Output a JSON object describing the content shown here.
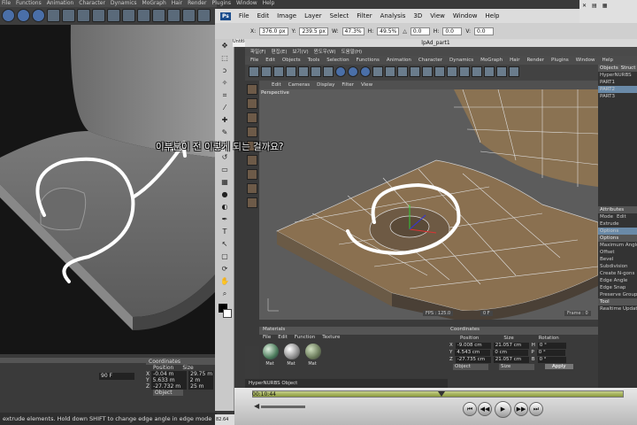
{
  "back_window": {
    "menu": [
      "File",
      "Functions",
      "Animation",
      "Character",
      "Dynamics",
      "MoGraph",
      "Hair",
      "Render",
      "Plugins",
      "Window",
      "Help"
    ],
    "timeline_frame": "90 F",
    "coords": {
      "header": "Coordinates",
      "position_label": "Position",
      "size_label": "Size",
      "rows": [
        {
          "axis": "X",
          "pos": "-0.04 m",
          "size": "29.75 m"
        },
        {
          "axis": "Y",
          "pos": "5.633 m",
          "size": "2 m"
        },
        {
          "axis": "Z",
          "pos": "-27.732 m",
          "size": "25 m"
        }
      ],
      "mode": "Object"
    },
    "status": "extrude elements. Hold down SHIFT to change edge angle in edge mode"
  },
  "photoshop": {
    "logo": "Ps",
    "menu": [
      "File",
      "Edit",
      "Image",
      "Layer",
      "Select",
      "Filter",
      "Analysis",
      "3D",
      "View",
      "Window",
      "Help"
    ],
    "options": [
      {
        "label": "X:",
        "value": "376.0 px"
      },
      {
        "label": "Y:",
        "value": "239.5 px"
      },
      {
        "label": "W:",
        "value": "47.3%"
      },
      {
        "label": "H:",
        "value": "49.5%"
      },
      {
        "label": "",
        "value": "0.0"
      },
      {
        "label": "H:",
        "value": "0.0"
      },
      {
        "label": "V:",
        "value": "0.0"
      }
    ],
    "doc_title": "lpAd_part1",
    "tab_label": "Untitled",
    "zoom": "82.64"
  },
  "inner_c4d": {
    "menu": [
      "파일(F)",
      "편집(E)",
      "보기(V)",
      "윈도우(W)",
      "도움말(H)"
    ],
    "menu2": [
      "File",
      "Edit",
      "Objects",
      "Tools",
      "Selection",
      "Functions",
      "Animation",
      "Character",
      "Dynamics",
      "MoGraph",
      "Hair",
      "Render",
      "Plugins",
      "Window",
      "Help"
    ],
    "view_menu": [
      "Edit",
      "Cameras",
      "Display",
      "Filter",
      "View"
    ],
    "viewport_label": "Perspective",
    "fps": "FPS : 125.0",
    "frame": "0 F",
    "frame_right": "Frame : 0",
    "objects_tab": "Objects",
    "objects_tab2": "Struct",
    "object_list": [
      "HyperNURBS",
      "PART1",
      "PART2",
      "PART3"
    ],
    "attributes_header": "Attributes",
    "attributes_tabs": [
      "Mode",
      "Edit"
    ],
    "attributes_tool": "Extrude",
    "options_tab": "Options",
    "options_header": "Options",
    "option_labels": [
      "Maximum Angle",
      "Offset",
      "Bevel",
      "Subdivision",
      "Create N-gons",
      "Edge Angle",
      "Edge Snap",
      "Preserve Groups"
    ],
    "tool_header": "Tool",
    "tool_label": "Realtime Update",
    "materials": {
      "header": "Materials",
      "menu": [
        "File",
        "Edit",
        "Function",
        "Texture"
      ],
      "balls": [
        "Mat",
        "Mat",
        "Mat"
      ]
    },
    "coordinates": {
      "header": "Coordinates",
      "col_headers": [
        "Position",
        "Size",
        "Rotation"
      ],
      "rows": [
        {
          "axis": "X",
          "pos": "-9.008 cm",
          "size": "21.057 cm",
          "rot_axis": "H",
          "rot": "0 °"
        },
        {
          "axis": "Y",
          "pos": "4.543 cm",
          "size": "0 cm",
          "rot_axis": "P",
          "rot": "0 °"
        },
        {
          "axis": "Z",
          "pos": "-27.735 cm",
          "size": "21.057 cm",
          "rot_axis": "B",
          "rot": "0 °"
        }
      ],
      "mode": "Object",
      "size_mode": "Size",
      "apply": "Apply"
    },
    "status": "HyperNURBS Object"
  },
  "quicktime": {
    "time": "00:10:44"
  },
  "caption": "이부분이 전 이렇게 되는 걸까요?",
  "colors": {
    "accent": "#4a6fa8",
    "surface": "#8a7050",
    "highlight": "#ffffff"
  }
}
